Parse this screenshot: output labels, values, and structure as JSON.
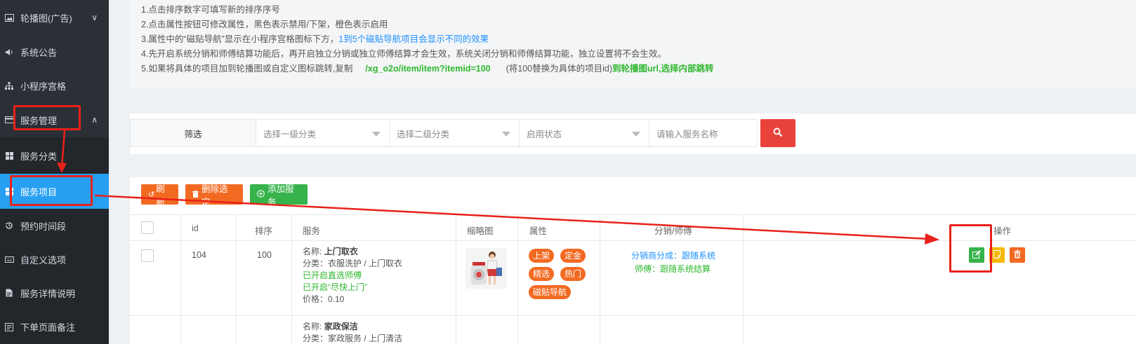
{
  "sidebar": {
    "items": [
      {
        "label": "轮播图(广告)",
        "icon": "image-icon",
        "chevron": "∨"
      },
      {
        "label": "系统公告",
        "icon": "speaker-icon"
      },
      {
        "label": "小程序宫格",
        "icon": "sitemap-icon"
      },
      {
        "label": "服务管理",
        "icon": "card-icon",
        "chevron": "∧"
      },
      {
        "label": "服务分类",
        "icon": "grid-icon"
      },
      {
        "label": "服务项目",
        "icon": "grid-icon",
        "active": true
      },
      {
        "label": "预约时间段",
        "icon": "history-icon"
      },
      {
        "label": "自定义选项",
        "icon": "keyboard-icon"
      },
      {
        "label": "服务详情说明",
        "icon": "document-icon"
      },
      {
        "label": "下单页面备注",
        "icon": "note-icon"
      }
    ]
  },
  "notes": {
    "line1": "1.点击排序数字可填写新的排序序号",
    "line2": "2.点击属性按钮可修改属性，黑色表示禁用/下架，橙色表示启用",
    "line3_a": "3.属性中的“磁贴导航”显示在小程序宫格图标下方，",
    "line3_b": "1到5个磁贴导航项目会显示不同的效果",
    "line4": "4.先开启系统分销和师傅结算功能后，再开启独立分销或独立师傅结算才会生效，系统关闭分销和师傅结算功能，独立设置将不会生效。",
    "line5_a": "5.如果将具体的项目加到轮播图或自定义图标跳转,复制",
    "line5_b": "/xg_o2o/item/item?itemid=100",
    "line5_c": "(将100替换为具体的项目id)",
    "line5_d": "到轮播图url,选择内部跳转"
  },
  "filter": {
    "label": "筛选",
    "select1": "选择一级分类",
    "select2": "选择二级分类",
    "select3": "启用状态",
    "search_placeholder": "请输入服务名称"
  },
  "toolbar": {
    "refresh": "刷新",
    "delete_selected": "删除选定",
    "add_service": "添加服务"
  },
  "table": {
    "headers": {
      "id": "id",
      "sort": "排序",
      "service": "服务",
      "thumb": "缩略图",
      "attr": "属性",
      "dist": "分销/师傅",
      "op": "操作"
    },
    "rows": [
      {
        "id": "104",
        "sort": "100",
        "name_label": "名称:",
        "name": "上门取衣",
        "category": "分类：衣服洗护 / 上门取衣",
        "direct": "已开启直选师傅",
        "fast": "已开启“尽快上门”",
        "price": "价格：0.10",
        "tags": [
          "上架",
          "定金",
          "精选",
          "热门",
          "磁贴导航"
        ],
        "dist_label": "分销商分成：",
        "dist_value": "跟随系统",
        "master_label": "师傅：",
        "master_value": "跟随系统结算"
      },
      {
        "name_label": "名称:",
        "name": "家政保洁",
        "category": "分类：家政服务 / 上门清洁"
      }
    ]
  },
  "colors": {
    "sidebar_bg": "#2b2f36",
    "active": "#27a0f2",
    "orange": "#f26a22",
    "green": "#36b34a",
    "yellow": "#f5b800",
    "red_search": "#e8423b",
    "annotation_red": "#e8211a"
  }
}
